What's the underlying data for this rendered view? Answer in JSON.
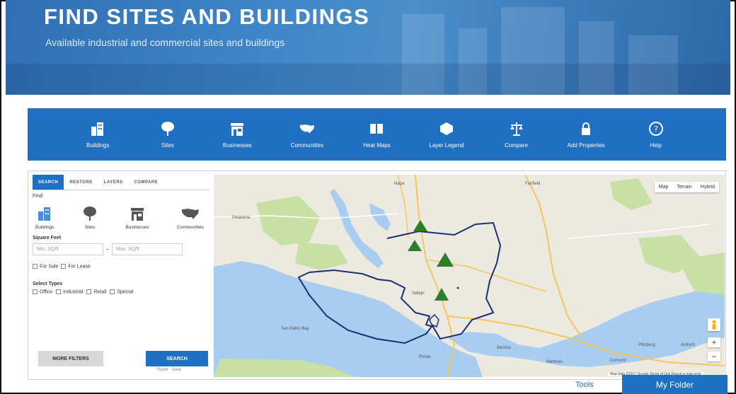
{
  "hero": {
    "title": "FIND SITES AND BUILDINGS",
    "subtitle": "Available industrial and commercial sites and buildings"
  },
  "nav": {
    "items": [
      {
        "label": "Buildings",
        "icon": "buildings-icon"
      },
      {
        "label": "Sites",
        "icon": "tree-icon"
      },
      {
        "label": "Businesses",
        "icon": "storefront-icon"
      },
      {
        "label": "Communities",
        "icon": "usa-map-icon"
      },
      {
        "label": "Heat Maps",
        "icon": "book-map-icon"
      },
      {
        "label": "Layer Legend",
        "icon": "layers-icon"
      },
      {
        "label": "Compare",
        "icon": "scales-icon"
      },
      {
        "label": "Add Properties",
        "icon": "lock-icon"
      },
      {
        "label": "Help",
        "icon": "question-icon"
      }
    ]
  },
  "search_panel": {
    "tabs": [
      "SEARCH",
      "RESTORE",
      "LAYERS",
      "COMPARE"
    ],
    "find_label": "Find:",
    "types": [
      {
        "label": "Buildings",
        "icon": "buildings-icon"
      },
      {
        "label": "Sites",
        "icon": "tree-icon"
      },
      {
        "label": "Businesses",
        "icon": "storefront-icon"
      },
      {
        "label": "Communities",
        "icon": "usa-map-icon"
      }
    ],
    "square_feet_label": "Square Feet",
    "min_placeholder": "Min. SQ/ft",
    "max_placeholder": "Max. SQ/ft",
    "for_sale": "For Sale",
    "for_lease": "For Lease",
    "select_types_label": "Select Types",
    "type_options": [
      "Office",
      "Industrial",
      "Retail",
      "Special"
    ],
    "more_filters": "MORE FILTERS",
    "search_button": "SEARCH",
    "reset_label": "Reset",
    "save_label": "Save"
  },
  "map": {
    "map_types": [
      "Map",
      "Terrain",
      "Hybrid"
    ],
    "labels": [
      "Napa",
      "Fairfield",
      "Petaluma",
      "Vallejo",
      "Benicia",
      "Concord",
      "San Pablo Bay",
      "Pinole",
      "Martinez",
      "Antioch",
      "Pittsburg"
    ],
    "attribution": "Map data ©2017 Google  Terms of Use  Report a map error"
  },
  "footer": {
    "tools": "Tools",
    "my_folder": "My Folder"
  },
  "colors": {
    "brand_blue": "#1f6fc3",
    "water": "#a8cdf0",
    "park": "#c7e1a4",
    "boundary": "#1b2f78",
    "marker": "#2e7d2e"
  }
}
